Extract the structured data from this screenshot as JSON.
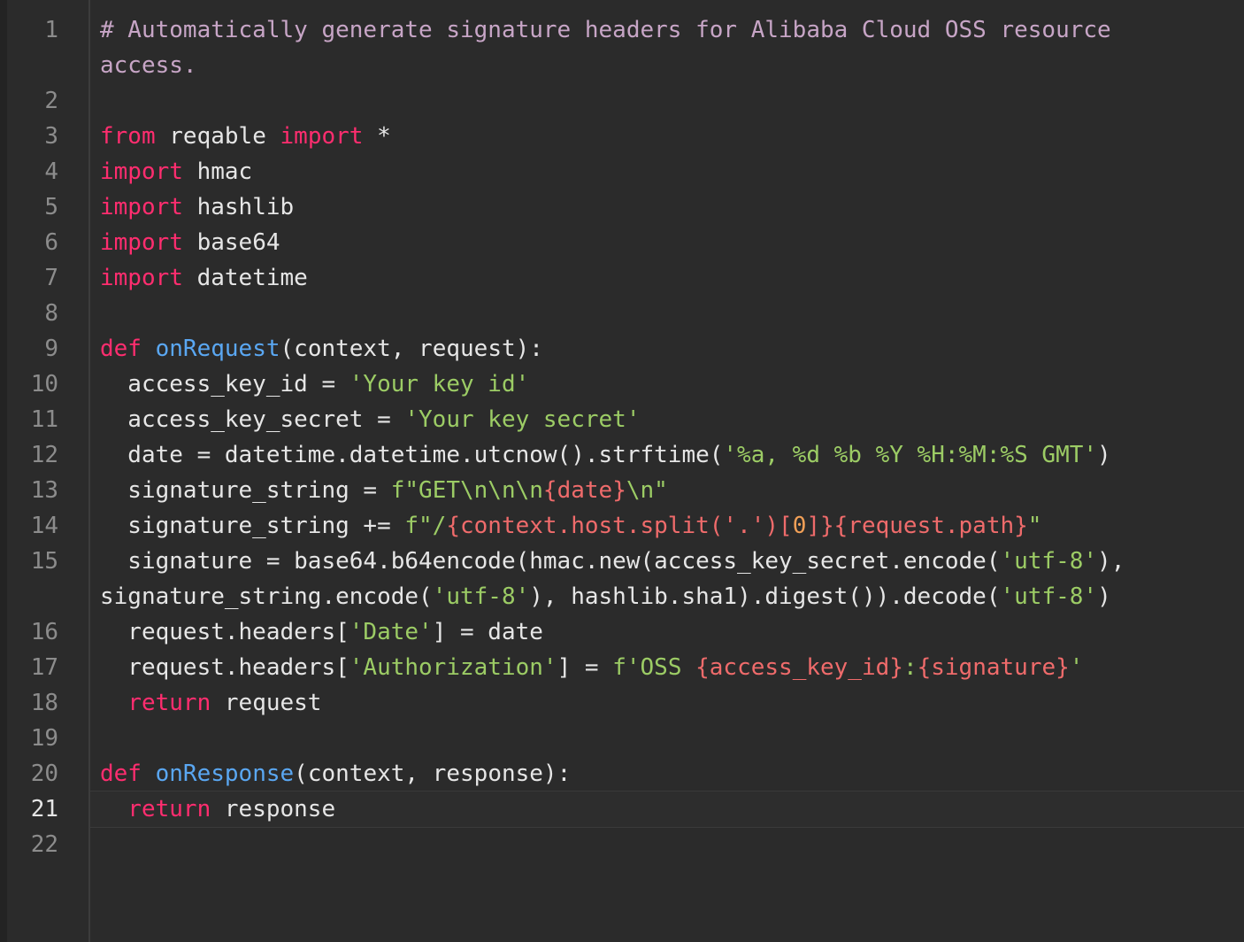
{
  "editor": {
    "line_numbers": [
      "1",
      "2",
      "3",
      "4",
      "5",
      "6",
      "7",
      "8",
      "9",
      "10",
      "11",
      "12",
      "13",
      "14",
      "15",
      "16",
      "17",
      "18",
      "19",
      "20",
      "21",
      "22"
    ],
    "active_line": "21",
    "colors": {
      "background": "#2b2b2b",
      "comment": "#c7a5c6",
      "keyword": "#ff2d6f",
      "function": "#5aa7f2",
      "string": "#9ccc65",
      "interpolation": "#ef6b6b",
      "number": "#f2a057",
      "text": "#e6e6e6"
    },
    "lines": [
      [
        {
          "t": "com",
          "v": "# Automatically generate signature headers for Alibaba Cloud OSS resource"
        }
      ],
      [
        {
          "t": "com",
          "v": "access."
        }
      ],
      [],
      [
        {
          "t": "kw",
          "v": "from"
        },
        {
          "t": "txt",
          "v": " reqable "
        },
        {
          "t": "kw",
          "v": "import"
        },
        {
          "t": "txt",
          "v": " *"
        }
      ],
      [
        {
          "t": "kw",
          "v": "import"
        },
        {
          "t": "txt",
          "v": " hmac"
        }
      ],
      [
        {
          "t": "kw",
          "v": "import"
        },
        {
          "t": "txt",
          "v": " hashlib"
        }
      ],
      [
        {
          "t": "kw",
          "v": "import"
        },
        {
          "t": "txt",
          "v": " base64"
        }
      ],
      [
        {
          "t": "kw",
          "v": "import"
        },
        {
          "t": "txt",
          "v": " datetime"
        }
      ],
      [],
      [
        {
          "t": "kw",
          "v": "def"
        },
        {
          "t": "txt",
          "v": " "
        },
        {
          "t": "fn",
          "v": "onRequest"
        },
        {
          "t": "txt",
          "v": "(context, request):"
        }
      ],
      [
        {
          "t": "txt",
          "v": "  access_key_id = "
        },
        {
          "t": "str",
          "v": "'Your key id'"
        }
      ],
      [
        {
          "t": "txt",
          "v": "  access_key_secret = "
        },
        {
          "t": "str",
          "v": "'Your key secret'"
        }
      ],
      [
        {
          "t": "txt",
          "v": "  date = datetime.datetime.utcnow().strftime("
        },
        {
          "t": "str",
          "v": "'%a, %d %b %Y %H:%M:%S GMT'"
        },
        {
          "t": "txt",
          "v": ")"
        }
      ],
      [
        {
          "t": "txt",
          "v": "  signature_string = "
        },
        {
          "t": "str",
          "v": "f\"GET\\n\\n\\n"
        },
        {
          "t": "int",
          "v": "{date}"
        },
        {
          "t": "str",
          "v": "\\n\""
        }
      ],
      [
        {
          "t": "txt",
          "v": "  signature_string += "
        },
        {
          "t": "str",
          "v": "f\"/"
        },
        {
          "t": "int",
          "v": "{context.host.split('.')["
        },
        {
          "t": "num",
          "v": "0"
        },
        {
          "t": "int",
          "v": "]}{request.path}"
        },
        {
          "t": "str",
          "v": "\""
        }
      ],
      [
        {
          "t": "txt",
          "v": "  signature = base64.b64encode(hmac.new(access_key_secret.encode("
        },
        {
          "t": "str",
          "v": "'utf-8'"
        },
        {
          "t": "txt",
          "v": "),"
        }
      ],
      [
        {
          "t": "txt",
          "v": "signature_string.encode("
        },
        {
          "t": "str",
          "v": "'utf-8'"
        },
        {
          "t": "txt",
          "v": "), hashlib.sha1).digest()).decode("
        },
        {
          "t": "str",
          "v": "'utf-8'"
        },
        {
          "t": "txt",
          "v": ")"
        }
      ],
      [
        {
          "t": "txt",
          "v": "  request.headers["
        },
        {
          "t": "str",
          "v": "'Date'"
        },
        {
          "t": "txt",
          "v": "] = date"
        }
      ],
      [
        {
          "t": "txt",
          "v": "  request.headers["
        },
        {
          "t": "str",
          "v": "'Authorization'"
        },
        {
          "t": "txt",
          "v": "] = "
        },
        {
          "t": "str",
          "v": "f'OSS "
        },
        {
          "t": "int",
          "v": "{access_key_id}"
        },
        {
          "t": "str",
          "v": ":"
        },
        {
          "t": "int",
          "v": "{signature}"
        },
        {
          "t": "str",
          "v": "'"
        }
      ],
      [
        {
          "t": "txt",
          "v": "  "
        },
        {
          "t": "kw",
          "v": "return"
        },
        {
          "t": "txt",
          "v": " request"
        }
      ],
      [],
      [
        {
          "t": "kw",
          "v": "def"
        },
        {
          "t": "txt",
          "v": " "
        },
        {
          "t": "fn",
          "v": "onResponse"
        },
        {
          "t": "txt",
          "v": "(context, response):"
        }
      ],
      [
        {
          "t": "txt",
          "v": "  "
        },
        {
          "t": "kw",
          "v": "return"
        },
        {
          "t": "txt",
          "v": " response"
        }
      ],
      []
    ]
  }
}
